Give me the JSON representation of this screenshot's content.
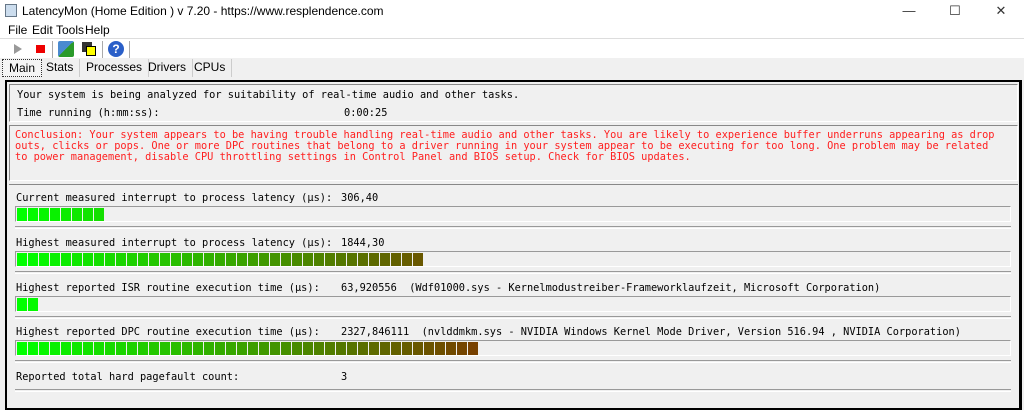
{
  "window": {
    "title": "LatencyMon  (Home Edition )  v 7.20 - https://www.resplendence.com",
    "minimize": "—",
    "maximize": "☐",
    "close": "✕"
  },
  "menu": [
    "File",
    "Edit",
    "Tools",
    "Help"
  ],
  "toolbar": {
    "icons": [
      "play-icon",
      "stop-icon",
      "analyze-icon",
      "window-icon",
      "help-icon"
    ]
  },
  "tabs": [
    "Main",
    "Stats",
    "Processes",
    "Drivers",
    "CPUs"
  ],
  "status": {
    "line": "Your system is being analyzed for suitability of real-time audio and other tasks.",
    "time_label": "Time running (h:mm:ss):",
    "time_value": "0:00:25"
  },
  "conclusion": [
    "Conclusion: Your system appears to be having trouble handling real-time audio and other tasks. You are likely to experience buffer underruns appearing as drop",
    "outs, clicks or pops. One or more DPC routines that belong to a driver running in your system appear to be executing for too long. One problem may be related",
    "to power management, disable CPU throttling settings in Control Panel and BIOS setup. Check for BIOS updates."
  ],
  "colors": {
    "conclusion": "#ff2020",
    "bar_start": "#00ff00",
    "bar_end": "#7a3c00"
  },
  "metrics": [
    {
      "label": "Current measured interrupt to process latency (µs):",
      "value": "306,40",
      "level": 0.089
    },
    {
      "label": "Highest measured interrupt to process latency (µs):",
      "value": "1844,30",
      "level": 0.411
    },
    {
      "label": "Highest reported ISR routine execution time (µs):",
      "value": "63,920556  (Wdf01000.sys - Kernelmodustreiber-Frameworklaufzeit, Microsoft Corporation)",
      "level": 0.022
    },
    {
      "label": "Highest reported DPC routine execution time (µs):",
      "value": "2327,846111  (nvlddmkm.sys - NVIDIA Windows Kernel Mode Driver, Version 516.94 , NVIDIA Corporation)",
      "level": 0.467
    },
    {
      "label": "Reported total hard pagefault count:",
      "value": "3"
    }
  ]
}
